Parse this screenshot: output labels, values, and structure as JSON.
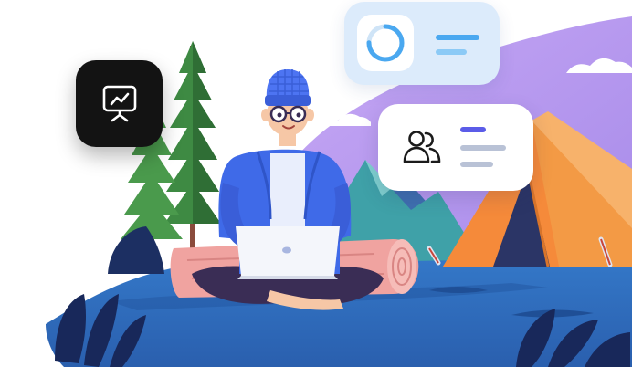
{
  "illustration": {
    "widgets": {
      "analytics_card": {
        "icon": "progress-ring-icon",
        "accent": "#4aa8f0",
        "track": "#cfe4f7"
      },
      "team_card": {
        "icon": "users-icon",
        "accent": "#5b5ce8",
        "muted": "#b9c2d6"
      },
      "presentation_tile": {
        "icon": "presentation-chart-icon",
        "background": "#131313"
      }
    },
    "colors": {
      "sky_purple": "#b79af2",
      "tent_orange": "#f58a3a",
      "ground_blue": "#2e6fc0",
      "jacket_blue": "#3f6ae8",
      "beanie_blue": "#4d74f2",
      "log_pink": "#f0a3a0",
      "pants_navy": "#3a2d55",
      "tree_green": "#3e8a43"
    }
  }
}
